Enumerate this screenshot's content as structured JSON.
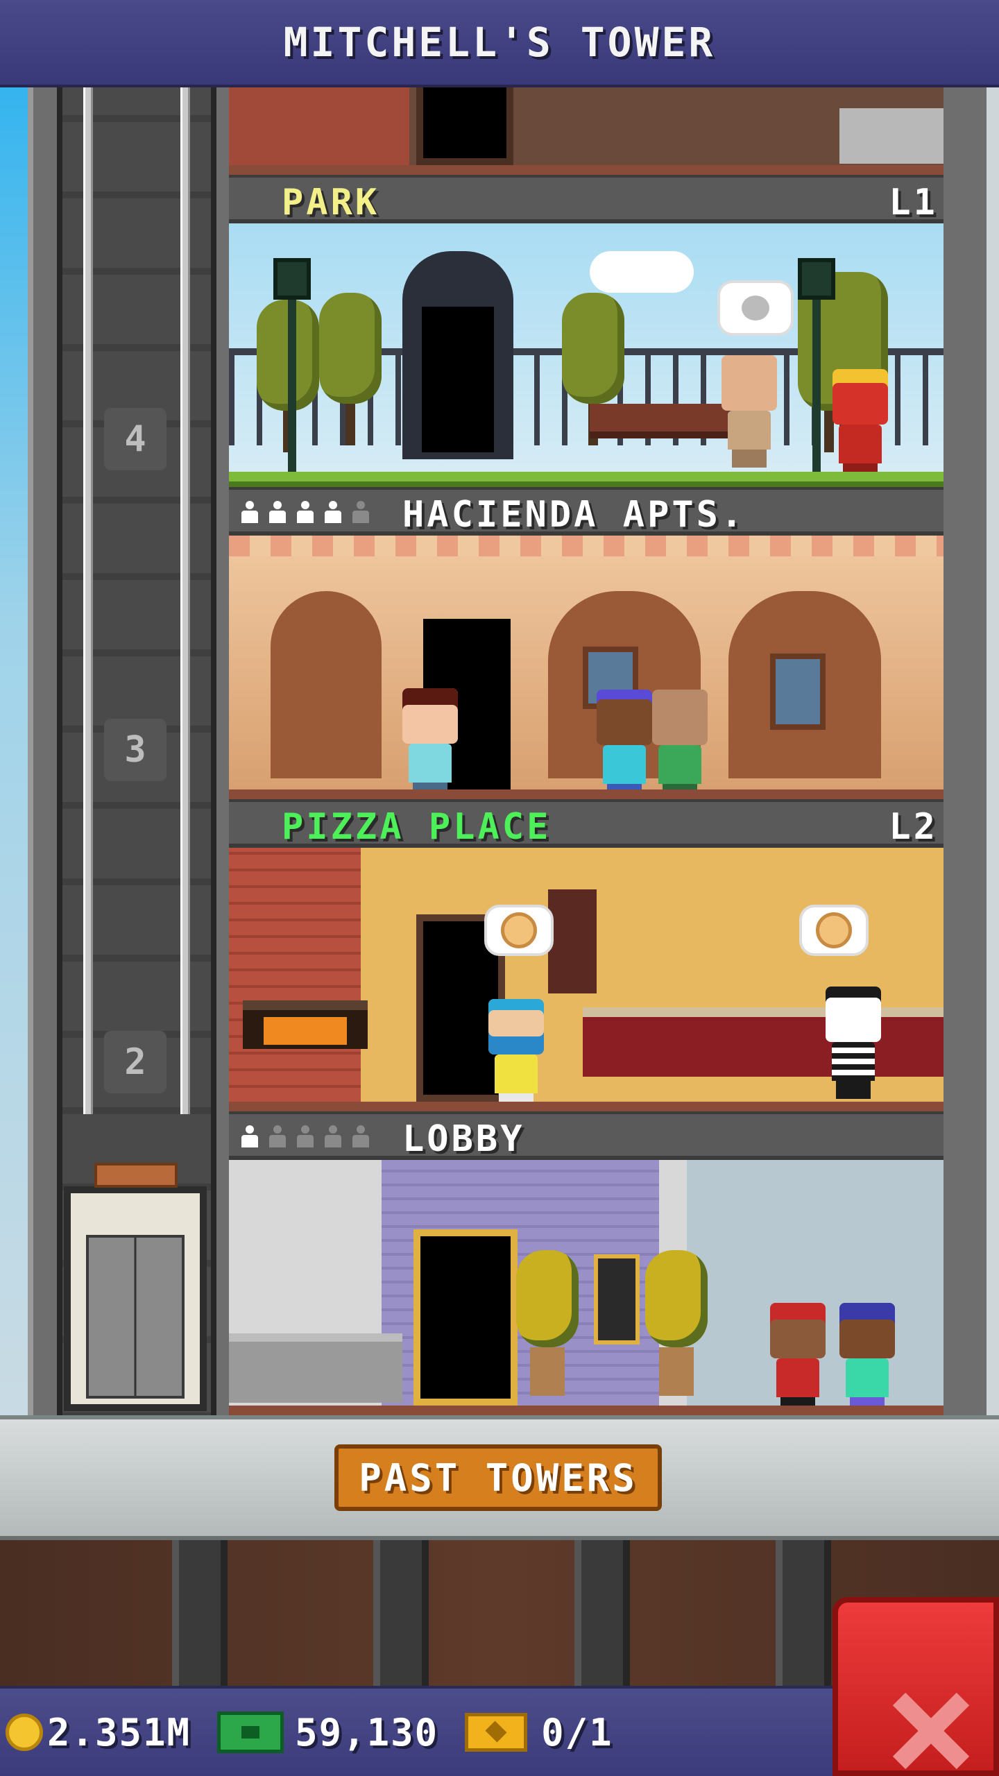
{
  "header": {
    "title": "MITCHELL'S TOWER"
  },
  "elevator": {
    "floor_numbers": [
      "4",
      "3",
      "2"
    ]
  },
  "floors": [
    {
      "name": "PARK",
      "level": "L1",
      "name_color": "#f3f08a",
      "type": "park",
      "stars": null
    },
    {
      "name": "HACIENDA APTS.",
      "level": "",
      "name_color": "#ffffff",
      "type": "residential",
      "stars": {
        "filled": 4,
        "total": 5
      }
    },
    {
      "name": "PIZZA PLACE",
      "level": "L2",
      "name_color": "#4ef05a",
      "type": "food",
      "stars": null
    },
    {
      "name": "LOBBY",
      "level": "",
      "name_color": "#ffffff",
      "type": "lobby",
      "stars": {
        "filled": 1,
        "total": 5
      }
    }
  ],
  "buttons": {
    "past_towers": "PAST TOWERS"
  },
  "currency": {
    "coins": "2.351M",
    "bux": "59,130",
    "tickets": "0/1"
  },
  "icons": {
    "coin": "coin-icon",
    "bux": "bux-icon",
    "ticket": "golden-ticket-icon",
    "close": "close-icon"
  },
  "colors": {
    "bar": "#3b3b7b",
    "button": "#d57f1e",
    "close": "#d92a2a"
  }
}
